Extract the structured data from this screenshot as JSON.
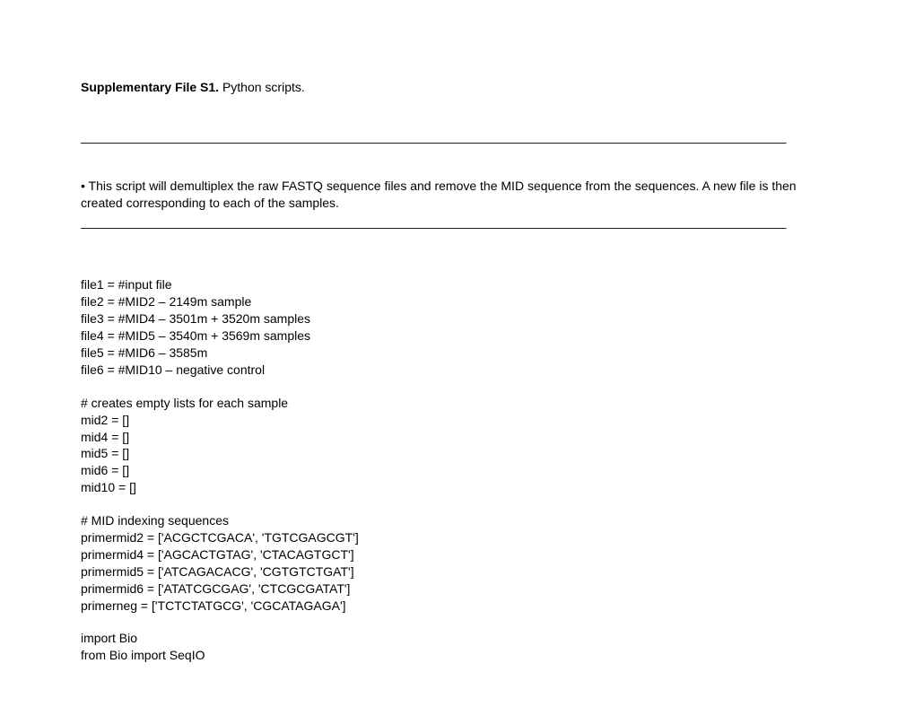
{
  "title_bold": "Supplementary File S1.",
  "title_rest": " Python scripts.",
  "hr": "_____________________________________________________________________________________________________",
  "description": "• This script will demultiplex the raw FASTQ sequence files and remove the MID sequence from the sequences. A new file is then created corresponding to each of the samples.",
  "file_defs": [
    "file1 = #input file",
    "file2 = #MID2 – 2149m sample",
    "file3 = #MID4 – 3501m + 3520m samples",
    "file4 = #MID5 – 3540m + 3569m samples",
    "file5 = #MID6 – 3585m",
    "file6 = #MID10 – negative control"
  ],
  "empty_lists_comment": "# creates empty lists for each sample",
  "empty_lists": [
    "mid2 = []",
    "mid4 = []",
    "mid5 = []",
    "mid6 = []",
    "mid10 = []"
  ],
  "mid_comment": "# MID indexing sequences",
  "primers": [
    "primermid2 = ['ACGCTCGACA', 'TGTCGAGCGT']",
    "primermid4 = ['AGCACTGTAG', 'CTACAGTGCT']",
    "primermid5 = ['ATCAGACACG', 'CGTGTCTGAT']",
    "primermid6 = ['ATATCGCGAG', 'CTCGCGATAT']",
    "primerneg = ['TCTCTATGCG', 'CGCATAGAGA']"
  ],
  "imports": [
    "import Bio",
    "from Bio import SeqIO"
  ]
}
